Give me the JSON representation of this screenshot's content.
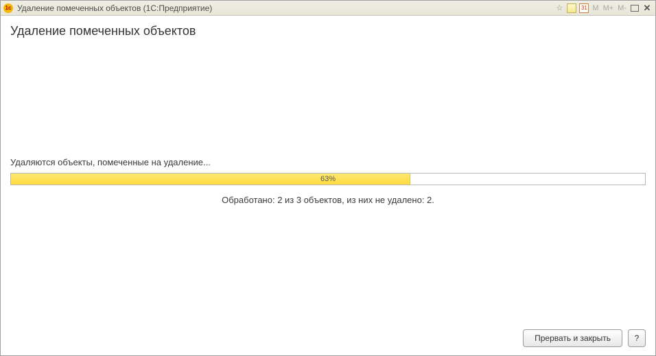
{
  "titlebar": {
    "app_icon_text": "1c",
    "title": "Удаление помеченных объектов  (1С:Предприятие)",
    "calendar_text": "31",
    "m_label": "M",
    "m_plus_label": "M+",
    "m_minus_label": "M-",
    "close_glyph": "✕",
    "star_glyph": "☆"
  },
  "page": {
    "title": "Удаление помеченных объектов",
    "status_text": "Удаляются объекты, помеченные на удаление...",
    "summary_text": "Обработано: 2 из 3 объектов, из них не удалено: 2."
  },
  "progress": {
    "percent": 63,
    "label": "63%"
  },
  "footer": {
    "cancel_label": "Прервать и закрыть",
    "help_label": "?"
  }
}
